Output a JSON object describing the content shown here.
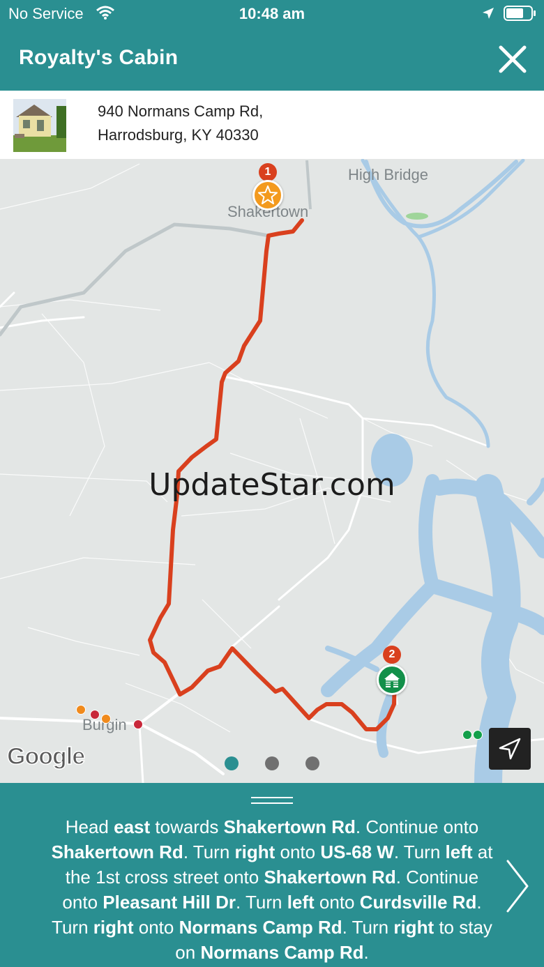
{
  "status_bar": {
    "carrier": "No Service",
    "time": "10:48 am",
    "icons": [
      "wifi-icon",
      "location-arrow-icon",
      "battery-icon"
    ]
  },
  "header": {
    "title": "Royalty's Cabin",
    "close_icon": "close-icon"
  },
  "address": {
    "line1": "940 Normans Camp Rd,",
    "line2": "Harrodsburg, KY 40330"
  },
  "map": {
    "labels": {
      "high_bridge": "High Bridge",
      "shakertown": "Shakertown",
      "burgin": "Burgin"
    },
    "start_marker": {
      "number": "1",
      "icon": "star-icon",
      "color": "#f39a1e"
    },
    "end_marker": {
      "number": "2",
      "icon": "cabin-icon",
      "color": "#13904a"
    },
    "route_color": "#d9401e",
    "watermark": "UpdateStar.com",
    "attribution": "Google",
    "page_indicator": {
      "count": 3,
      "active_index": 0
    },
    "navigate_icon": "navigation-arrow-icon"
  },
  "directions": {
    "segments": [
      {
        "t": "Head "
      },
      {
        "t": "east",
        "b": true
      },
      {
        "t": " towards "
      },
      {
        "t": "Shakertown Rd",
        "b": true
      },
      {
        "t": ". Continue onto "
      },
      {
        "t": "Shakertown Rd",
        "b": true
      },
      {
        "t": ". Turn "
      },
      {
        "t": "right",
        "b": true
      },
      {
        "t": " onto "
      },
      {
        "t": "US-68 W",
        "b": true
      },
      {
        "t": ". Turn "
      },
      {
        "t": "left",
        "b": true
      },
      {
        "t": " at the 1st cross street onto "
      },
      {
        "t": "Shakertown Rd",
        "b": true
      },
      {
        "t": ". Continue onto "
      },
      {
        "t": "Pleasant Hill Dr",
        "b": true
      },
      {
        "t": ". Turn "
      },
      {
        "t": "left",
        "b": true
      },
      {
        "t": " onto "
      },
      {
        "t": "Curdsville Rd",
        "b": true
      },
      {
        "t": ". Turn "
      },
      {
        "t": "right",
        "b": true
      },
      {
        "t": " onto "
      },
      {
        "t": "Normans Camp Rd",
        "b": true
      },
      {
        "t": ". Turn "
      },
      {
        "t": "right",
        "b": true
      },
      {
        "t": " to stay on "
      },
      {
        "t": "Normans Camp Rd",
        "b": true
      },
      {
        "t": "."
      }
    ],
    "next_icon": "chevron-right-icon"
  },
  "colors": {
    "brand": "#2a8f91",
    "water": "#a9cbe6",
    "land": "#e3e6e5"
  }
}
